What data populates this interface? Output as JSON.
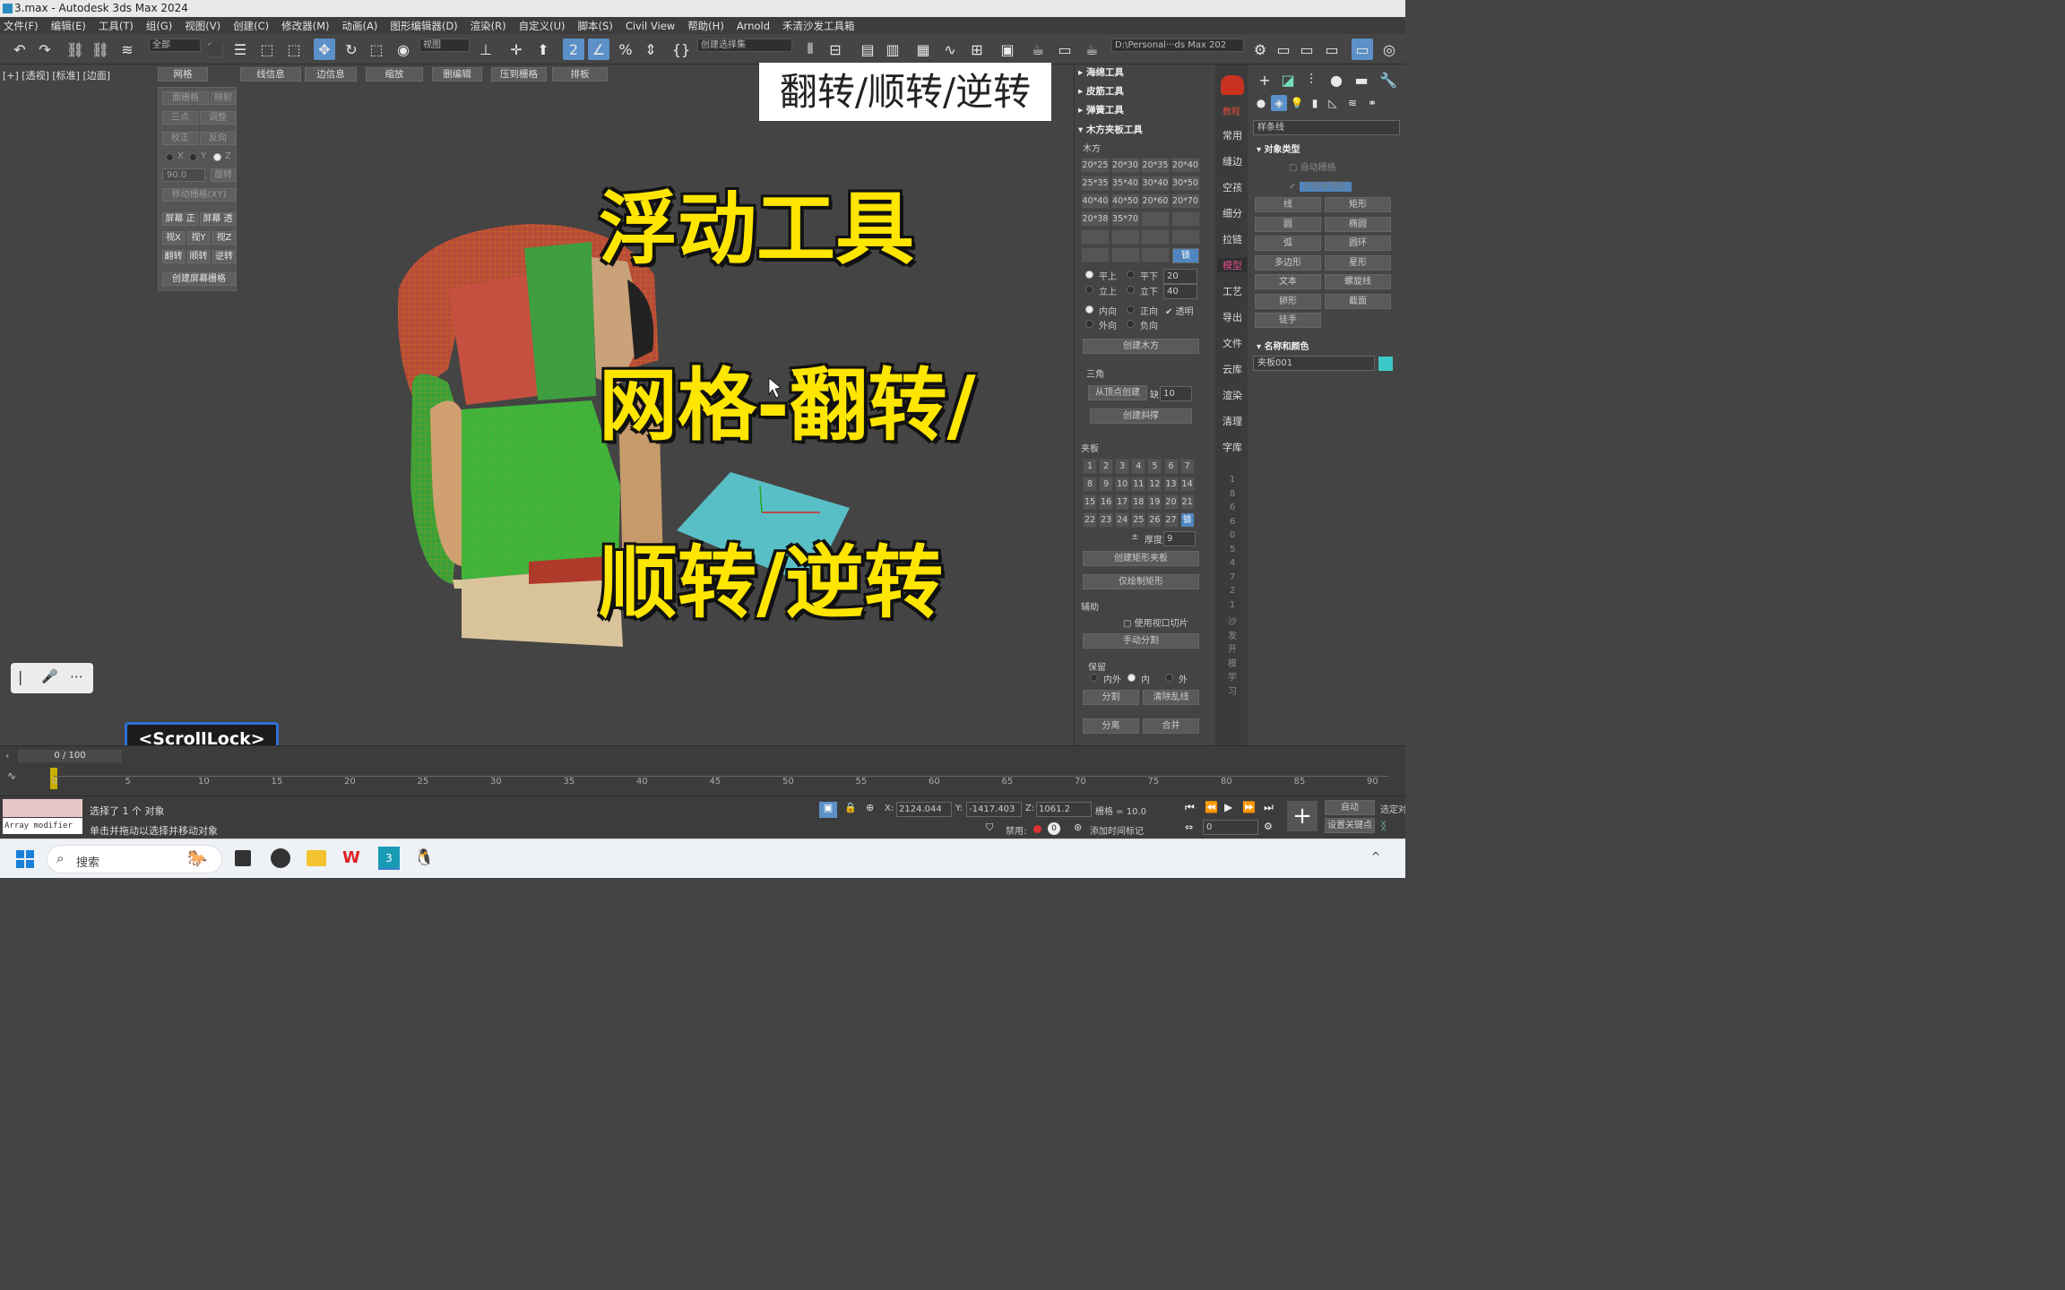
{
  "window": {
    "title": "3.max - Autodesk 3ds Max 2024"
  },
  "menu": [
    "文件(F)",
    "编辑(E)",
    "工具(T)",
    "组(G)",
    "视图(V)",
    "创建(C)",
    "修改器(M)",
    "动画(A)",
    "图形编辑器(D)",
    "渲染(R)",
    "自定义(U)",
    "脚本(S)",
    "Civil View",
    "帮助(H)",
    "Arnold",
    "禾清沙发工具箱"
  ],
  "toolbar": {
    "selection_filter": "全部",
    "ref_coord": "视图",
    "named_selection": "创建选择集",
    "project_path": "D:\\Personal···ds Max 202"
  },
  "viewport": {
    "label": "[+] [透视] [标准] [边面]",
    "ribbon": [
      "网格",
      "线信息",
      "边信息",
      "缩放",
      "删编辑",
      "压到栅格",
      "排板"
    ]
  },
  "float_panel": {
    "row1": [
      "面栅格",
      "映射"
    ],
    "row2": [
      "三点",
      "调整"
    ],
    "row3": [
      "校正",
      "反向"
    ],
    "axes": [
      "X",
      "Y",
      "Z"
    ],
    "angle": "90.0",
    "angle_btn": "旋转",
    "move_grid": "移动栅格(XY)",
    "screen": [
      "屏幕 正",
      "屏幕 透"
    ],
    "views": [
      "视X",
      "视Y",
      "视Z"
    ],
    "actions": [
      "翻转",
      "顺转",
      "逆转"
    ],
    "create_grid": "创建屏幕栅格"
  },
  "overlay": {
    "banner": "翻转/顺转/逆转",
    "line1": "浮动工具",
    "line2": "网格-翻转/",
    "line3": "顺转/逆转",
    "key_hint": "<ScrollLock>"
  },
  "rollouts": {
    "headers": [
      "海绵工具",
      "皮筋工具",
      "弹簧工具",
      "木方夹板工具"
    ],
    "wood_label": "木方",
    "wood_sizes": [
      [
        "20*25",
        "20*30",
        "20*35",
        "20*40"
      ],
      [
        "25*35",
        "35*40",
        "30*40",
        "30*50"
      ],
      [
        "40*40",
        "40*50",
        "20*60",
        "20*70"
      ],
      [
        "20*38",
        "35*70",
        "",
        ""
      ]
    ],
    "lock": "锁",
    "flat": [
      "平上",
      "平下"
    ],
    "stand": [
      "立上",
      "立下"
    ],
    "val20": "20",
    "val40": "40",
    "dir": [
      "内向",
      "正向",
      "透明",
      "外向",
      "负向"
    ],
    "create_wood": "创建木方",
    "triangle_label": "三角",
    "from_vertex": "从顶点创建",
    "gap_label": "缺",
    "gap_val": "10",
    "create_bevel": "创建斜撑",
    "clamp_label": "夹板",
    "clamp_nums": [
      [
        "1",
        "2",
        "3",
        "4",
        "5",
        "6",
        "7"
      ],
      [
        "8",
        "9",
        "10",
        "11",
        "12",
        "13",
        "14"
      ],
      [
        "15",
        "16",
        "17",
        "18",
        "19",
        "20",
        "21"
      ],
      [
        "22",
        "23",
        "24",
        "25",
        "26",
        "27",
        "锁"
      ]
    ],
    "thick_label": "厚度",
    "thick_val": "9",
    "create_rect_clamp": "创建矩形夹板",
    "draw_rect": "仅绘制矩形",
    "aux_label": "辅助",
    "use_slice": "使用视口切片",
    "manual_split": "手动分割",
    "keep_label": "保留",
    "keep_opts": [
      "内外",
      "内",
      "外"
    ],
    "split": "分割",
    "clear_lines": "清除乱线",
    "separate": "分离",
    "merge": "合并"
  },
  "side_tabs": [
    "常用",
    "缝边",
    "空孩",
    "细分",
    "拉链",
    "模型",
    "工艺",
    "导出",
    "文件",
    "云库",
    "渲染",
    "清理",
    "字库"
  ],
  "side_logo_text": "教程",
  "side_vertical": [
    "1",
    "8",
    "6",
    "6",
    "0",
    "5",
    "4",
    "7",
    "2",
    "1",
    "沙",
    "发",
    "开",
    "模",
    "学",
    "习"
  ],
  "command_panel": {
    "category": "样条线",
    "object_type_label": "对象类型",
    "auto_grid": "自动栅格",
    "start_new": "开始新图形",
    "shapes": [
      [
        "线",
        "矩形"
      ],
      [
        "圆",
        "椭圆"
      ],
      [
        "弧",
        "圆环"
      ],
      [
        "多边形",
        "星形"
      ],
      [
        "文本",
        "螺旋线"
      ],
      [
        "卵形",
        "截面"
      ],
      [
        "徒手",
        ""
      ]
    ],
    "name_color_label": "名称和颜色",
    "object_name": "夹板001",
    "object_color": "#3dc8c8"
  },
  "timeline": {
    "frame": "0 / 100",
    "ticks": [
      "0",
      "5",
      "10",
      "15",
      "20",
      "25",
      "30",
      "35",
      "40",
      "45",
      "50",
      "55",
      "60",
      "65",
      "70",
      "75",
      "80",
      "85",
      "90"
    ]
  },
  "status": {
    "modifier": "Array modifier",
    "selected": "选择了 1 个 对象",
    "hint": "单击并拖动以选择并移动对象",
    "x_label": "X:",
    "x": "2124.044",
    "y_label": "Y:",
    "y": "-1417.403",
    "z_label": "Z:",
    "z": "1061.2",
    "grid": "栅格 = 10.0",
    "disable": "禁用:",
    "add_time_tag": "添加时间标记",
    "auto": "自动",
    "set_key": "设置关键点",
    "sel_obj": "选定对",
    "frame_field": "0"
  },
  "taskbar": {
    "search": "搜索"
  }
}
